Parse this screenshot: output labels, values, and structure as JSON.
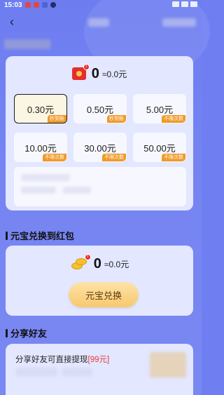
{
  "statusbar": {
    "time": "15:03"
  },
  "balance": {
    "amount": "0",
    "approx": "≈0.0元",
    "badge": "!"
  },
  "options": [
    {
      "value": "0.30元",
      "tag": "秒到账",
      "selected": true
    },
    {
      "value": "0.50元",
      "tag": "秒到账",
      "selected": false
    },
    {
      "value": "5.00元",
      "tag": "不限次数",
      "selected": false
    },
    {
      "value": "10.00元",
      "tag": "不限次数",
      "selected": false
    },
    {
      "value": "30.00元",
      "tag": "不限次数",
      "selected": false
    },
    {
      "value": "50.00元",
      "tag": "不限次数",
      "selected": false
    }
  ],
  "sections": {
    "exchange_title": "元宝兑换到红包",
    "share_title": "分享好友"
  },
  "exchange": {
    "amount": "0",
    "approx": "≈0.0元",
    "badge": "!",
    "button_label": "元宝兑换"
  },
  "share": {
    "text": "分享好友可直接提现",
    "highlight": "[99元]"
  },
  "colors": {
    "background": "#6f7ff2",
    "card": "#e3e7ff",
    "tag": "#f09a26",
    "button": "#f8c86e",
    "highlight": "#e53c3c"
  }
}
